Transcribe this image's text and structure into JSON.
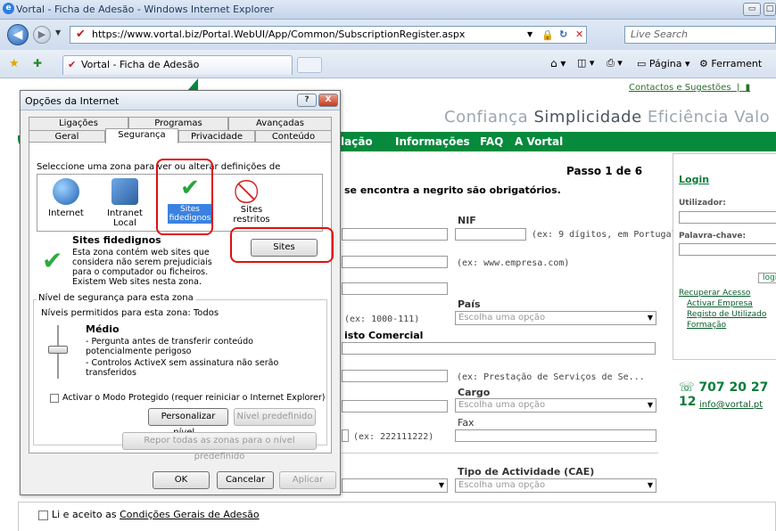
{
  "browser": {
    "window_title": "Vortal - Ficha de Adesão - Windows Internet Explorer",
    "url": "https://www.vortal.biz/Portal.WebUI/App/Common/SubscriptionRegister.aspx",
    "search_placeholder": "Live Search",
    "tab_title": "Vortal - Ficha de Adesão",
    "toolbar_page": "Página",
    "toolbar_tools": "Ferrament"
  },
  "site": {
    "contact_link": "Contactos e Sugestões",
    "slogan_1": "Confiança",
    "slogan_2": "Simplicidade",
    "slogan_3": "Eficiência",
    "slogan_4": "Valo",
    "nav": [
      "lação",
      "Informações",
      "FAQ",
      "A Vortal"
    ],
    "step": "Passo 1 de 6",
    "required_note": "se encontra a negrito são obrigatórios.",
    "nif_label": "NIF",
    "nif_hint": "(ex: 9 dígitos, em Portugal)",
    "web_hint": "(ex: www.empresa.com)",
    "pais_label": "País",
    "pais_select": "Escolha uma opção",
    "cp_hint": "(ex: 1000-111)",
    "registo_label": "isto Comercial",
    "activity_hint": "(ex: Prestação de Serviços de Se...",
    "cargo_label": "Cargo",
    "cargo_select": "Escolha uma opção",
    "fax_label": "Fax",
    "phone_hint": "(ex: 222111222)",
    "cae_label": "Tipo de Actividade (CAE)",
    "cae_select": "Escolha uma opção",
    "terms_prefix": "Li e aceito as ",
    "terms_link": "Condições Gerais de Adesão",
    "login": {
      "title": "Login",
      "user_label": "Utilizador:",
      "password_label": "Palavra-chave:",
      "login_btn": "logi",
      "links": [
        "Recuperar Acesso",
        "Activar Empresa",
        "Registo de Utilizado",
        "Formação"
      ]
    },
    "phone": "707 20 27 12",
    "email": "info@vortal.pt"
  },
  "dialog": {
    "title": "Opções da Internet",
    "tabs_top": [
      "Ligações",
      "Programas",
      "Avançadas"
    ],
    "tabs_bottom": [
      "Geral",
      "Segurança",
      "Privacidade",
      "Conteúdo"
    ],
    "zone_instruction": "Seleccione uma zona para ver ou alterar definições de segurança.",
    "zones": [
      "Internet",
      "Intranet Local",
      "Sites fidedignos",
      "Sites restritos"
    ],
    "zone_heading": "Sites fidedignos",
    "zone_desc": "Esta zona contém web sites que considera não serem prejudiciais para o computador ou ficheiros. Existem Web sites nesta zona.",
    "sites_btn": "Sites",
    "level_group": "Nível de segurança para esta zona",
    "allowed_levels": "Níveis permitidos para esta zona: Todos",
    "level_name": "Médio",
    "level_desc_1": "- Pergunta antes de transferir conteúdo potencialmente perigoso",
    "level_desc_2": "- Controlos ActiveX sem assinatura não serão transferidos",
    "protected_mode": "Activar o Modo Protegido (requer reiniciar o Internet Explorer)",
    "custom_level_btn": "Personalizar nível...",
    "default_level_btn": "Nível predefinido",
    "reset_all_btn": "Repor todas as zonas para o nível predefinido",
    "ok_btn": "OK",
    "cancel_btn": "Cancelar",
    "apply_btn": "Aplicar",
    "help_btn": "?",
    "close_btn": "X"
  }
}
